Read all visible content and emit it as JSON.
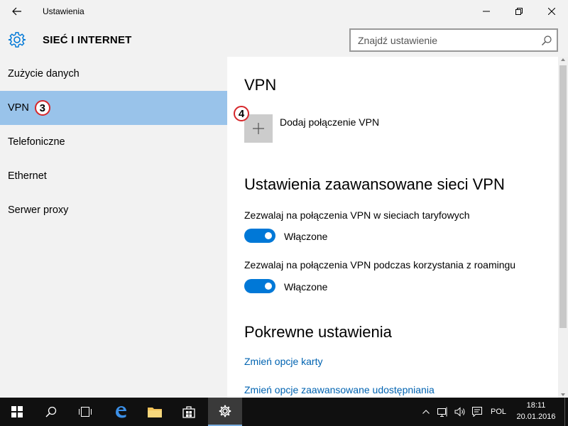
{
  "window": {
    "title": "Ustawienia"
  },
  "header": {
    "heading": "SIEĆ I INTERNET",
    "search_placeholder": "Znajdź ustawienie"
  },
  "sidebar": {
    "items": [
      {
        "label": "Zużycie danych"
      },
      {
        "label": "VPN",
        "badge": "3"
      },
      {
        "label": "Telefoniczne"
      },
      {
        "label": "Ethernet"
      },
      {
        "label": "Serwer proxy"
      }
    ],
    "selected": "VPN"
  },
  "main": {
    "vpn_title": "VPN",
    "add_badge": "4",
    "add_label": "Dodaj połączenie VPN",
    "advanced_title": "Ustawienia zaawansowane sieci VPN",
    "settings": [
      {
        "label": "Zezwalaj na połączenia VPN w sieciach taryfowych",
        "state": "Włączone",
        "on": true
      },
      {
        "label": "Zezwalaj na połączenia VPN podczas korzystania z roamingu",
        "state": "Włączone",
        "on": true
      }
    ],
    "related_title": "Pokrewne ustawienia",
    "links": [
      "Zmień opcje karty",
      "Zmień opcje zaawansowane udostępniania"
    ]
  },
  "taskbar": {
    "language": "POL",
    "time": "18:11",
    "date": "20.01.2016",
    "accent": "#0078d7"
  }
}
